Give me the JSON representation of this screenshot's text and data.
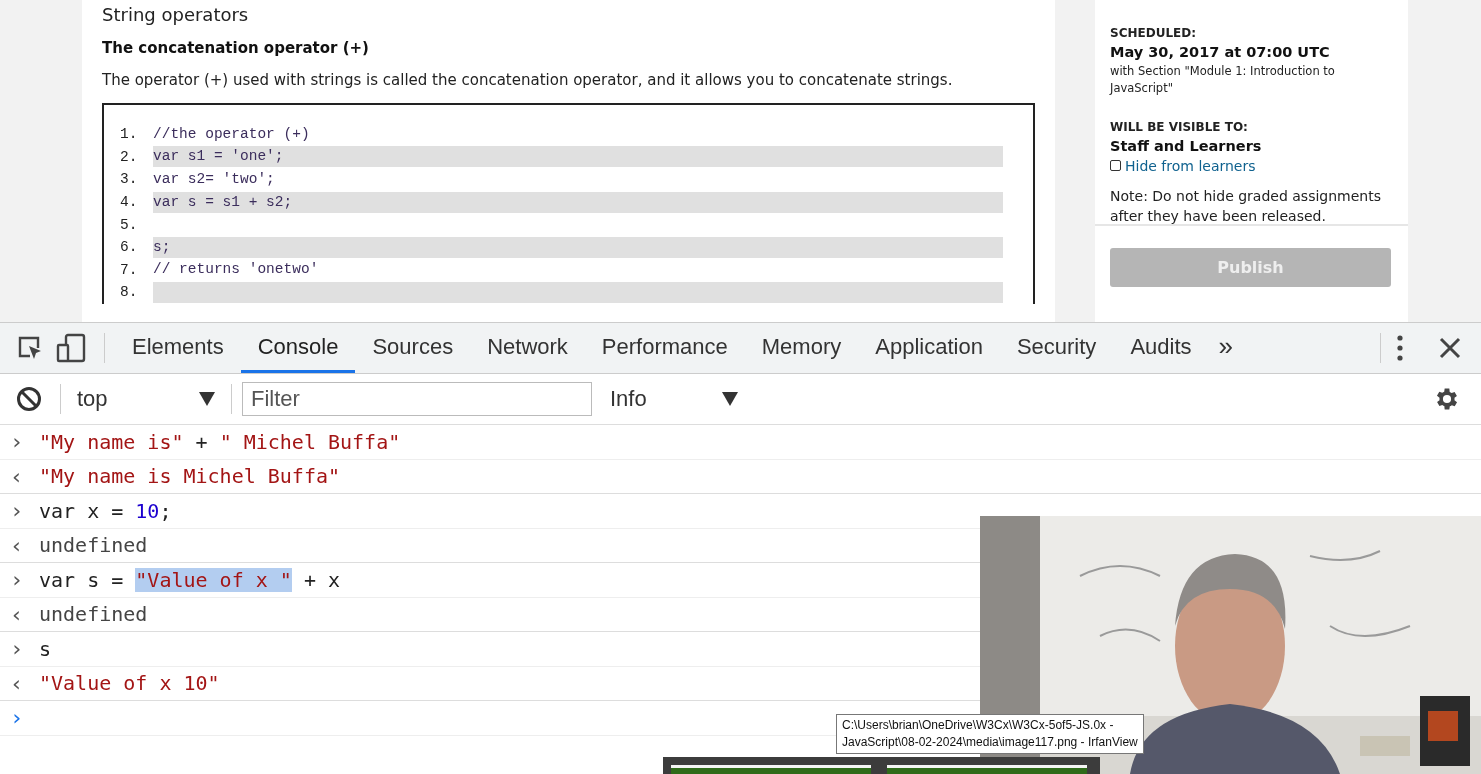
{
  "article": {
    "heading": "String operators",
    "subheading": "The concatenation operator (+)",
    "paragraph": "The operator (+) used with strings is called the concatenation operator, and it allows you to concatenate strings.",
    "code_lines": [
      {
        "number": "1.",
        "text": "//the operator (+)",
        "highlighted": false
      },
      {
        "number": "2.",
        "text": "var s1 = 'one';",
        "highlighted": true
      },
      {
        "number": "3.",
        "text": "var s2= 'two';",
        "highlighted": false
      },
      {
        "number": "4.",
        "text": "var s = s1 + s2;",
        "highlighted": true
      },
      {
        "number": "5.",
        "highlighted": false
      },
      {
        "number": "6.",
        "text": "s;",
        "highlighted": true
      },
      {
        "number": "7.",
        "text": "// returns 'onetwo'",
        "highlighted": false
      },
      {
        "number": "8.",
        "highlighted": true
      }
    ]
  },
  "sidebar": {
    "scheduled_label": "SCHEDULED:",
    "scheduled_date": "May 30, 2017 at 07:00 UTC",
    "scheduled_section": "with Section \"Module 1: Introduction to JavaScript\"",
    "visible_label": "WILL BE VISIBLE TO:",
    "visible_value": "Staff and Learners",
    "hide_checkbox": {
      "label": "Hide from learners",
      "checked": false
    },
    "note": "Note: Do not hide graded assignments after they have been released.",
    "publish_button": {
      "label": "Publish",
      "disabled": true
    }
  },
  "devtools": {
    "tabs": [
      {
        "label": "Elements",
        "selected": false
      },
      {
        "label": "Console",
        "selected": true
      },
      {
        "label": "Sources",
        "selected": false
      },
      {
        "label": "Network",
        "selected": false
      },
      {
        "label": "Performance",
        "selected": false
      },
      {
        "label": "Memory",
        "selected": false
      },
      {
        "label": "Application",
        "selected": false
      },
      {
        "label": "Security",
        "selected": false
      },
      {
        "label": "Audits",
        "selected": false
      }
    ],
    "overflow": "»",
    "context": "top",
    "filter": {
      "placeholder": "Filter"
    },
    "level": "Info",
    "console_rows": [
      {
        "kind": "input",
        "marker": "›",
        "parts": [
          {
            "text": "\"My name is\"",
            "kind": "string"
          },
          {
            "text": " + ",
            "kind": "plain"
          },
          {
            "text": "\" Michel Buffa\"",
            "kind": "string"
          }
        ]
      },
      {
        "kind": "output",
        "marker": "‹",
        "parts": [
          {
            "text": "\"My name is Michel Buffa\"",
            "kind": "string"
          }
        ]
      },
      {
        "kind": "input",
        "marker": "›",
        "parts": [
          {
            "text": "var x = ",
            "kind": "plain"
          },
          {
            "text": "10",
            "kind": "number"
          },
          {
            "text": ";",
            "kind": "plain"
          }
        ]
      },
      {
        "kind": "output",
        "marker": "‹",
        "parts": [
          {
            "text": "undefined",
            "kind": "muted"
          }
        ]
      },
      {
        "kind": "input",
        "marker": "›",
        "parts": [
          {
            "text": "var s = ",
            "kind": "plain"
          },
          {
            "text": "\"Value of x \"",
            "kind": "selected"
          },
          {
            "text": " + x",
            "kind": "plain"
          }
        ]
      },
      {
        "kind": "output",
        "marker": "‹",
        "parts": [
          {
            "text": "undefined",
            "kind": "muted"
          }
        ]
      },
      {
        "kind": "input",
        "marker": "›",
        "parts": [
          {
            "text": "s",
            "kind": "plain"
          }
        ]
      },
      {
        "kind": "output",
        "marker": "‹",
        "parts": [
          {
            "text": "\"Value of x 10\"",
            "kind": "string"
          }
        ]
      },
      {
        "kind": "prompt",
        "marker": "›",
        "parts": []
      }
    ]
  },
  "tooltip": "C:\\Users\\brian\\OneDrive\\W3Cx\\W3Cx-5of5-JS.0x - JavaScript\\08-02-2024\\media\\image117.png - IrfanView"
}
